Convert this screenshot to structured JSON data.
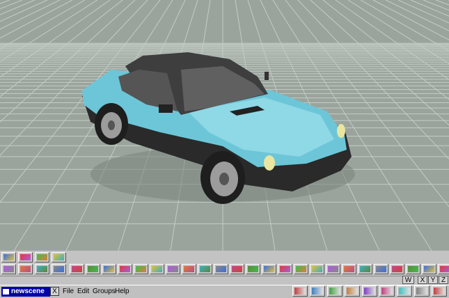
{
  "scene_button": {
    "label": "newscene"
  },
  "close_button": {
    "label": "X"
  },
  "menus": [
    {
      "label": "File"
    },
    {
      "label": "Edit"
    },
    {
      "label": "Groups"
    },
    {
      "label": "Help"
    }
  ],
  "view_selector": {
    "value": "W"
  },
  "axis_buttons": [
    {
      "label": "X"
    },
    {
      "label": "Y"
    },
    {
      "label": "Z"
    }
  ],
  "colors": {
    "viewport_bg": "#9aa49c",
    "grid_line": "#c4ccc6",
    "car_body": "#6cc6d8",
    "car_roof": "#4a4a4a",
    "toolbar_bg": "#c3c3c3",
    "scene_button_bg": "#0000a8"
  },
  "toolbar_icons": [
    "grid-icon",
    "axes-icon",
    "camera-icon",
    "render-icon",
    "undo-icon",
    "delete-icon",
    "move-axes-icon",
    "rotate-icon",
    "light-icon",
    "sphere-icon",
    "shapes-icon",
    "paint-icon",
    "select-arrow-icon",
    "box-icon",
    "torus-icon",
    "spray-icon",
    "arrow-tool-icon",
    "cube-icon",
    "fire-icon",
    "cylinder-icon",
    "texture-icon",
    "circle-icon",
    "lasso-icon",
    "path-icon",
    "plane-icon",
    "stripes-icon",
    "wave-icon",
    "mesh-icon",
    "spline-icon",
    "bones-icon",
    "magnet-icon",
    "keyframe-icon"
  ]
}
